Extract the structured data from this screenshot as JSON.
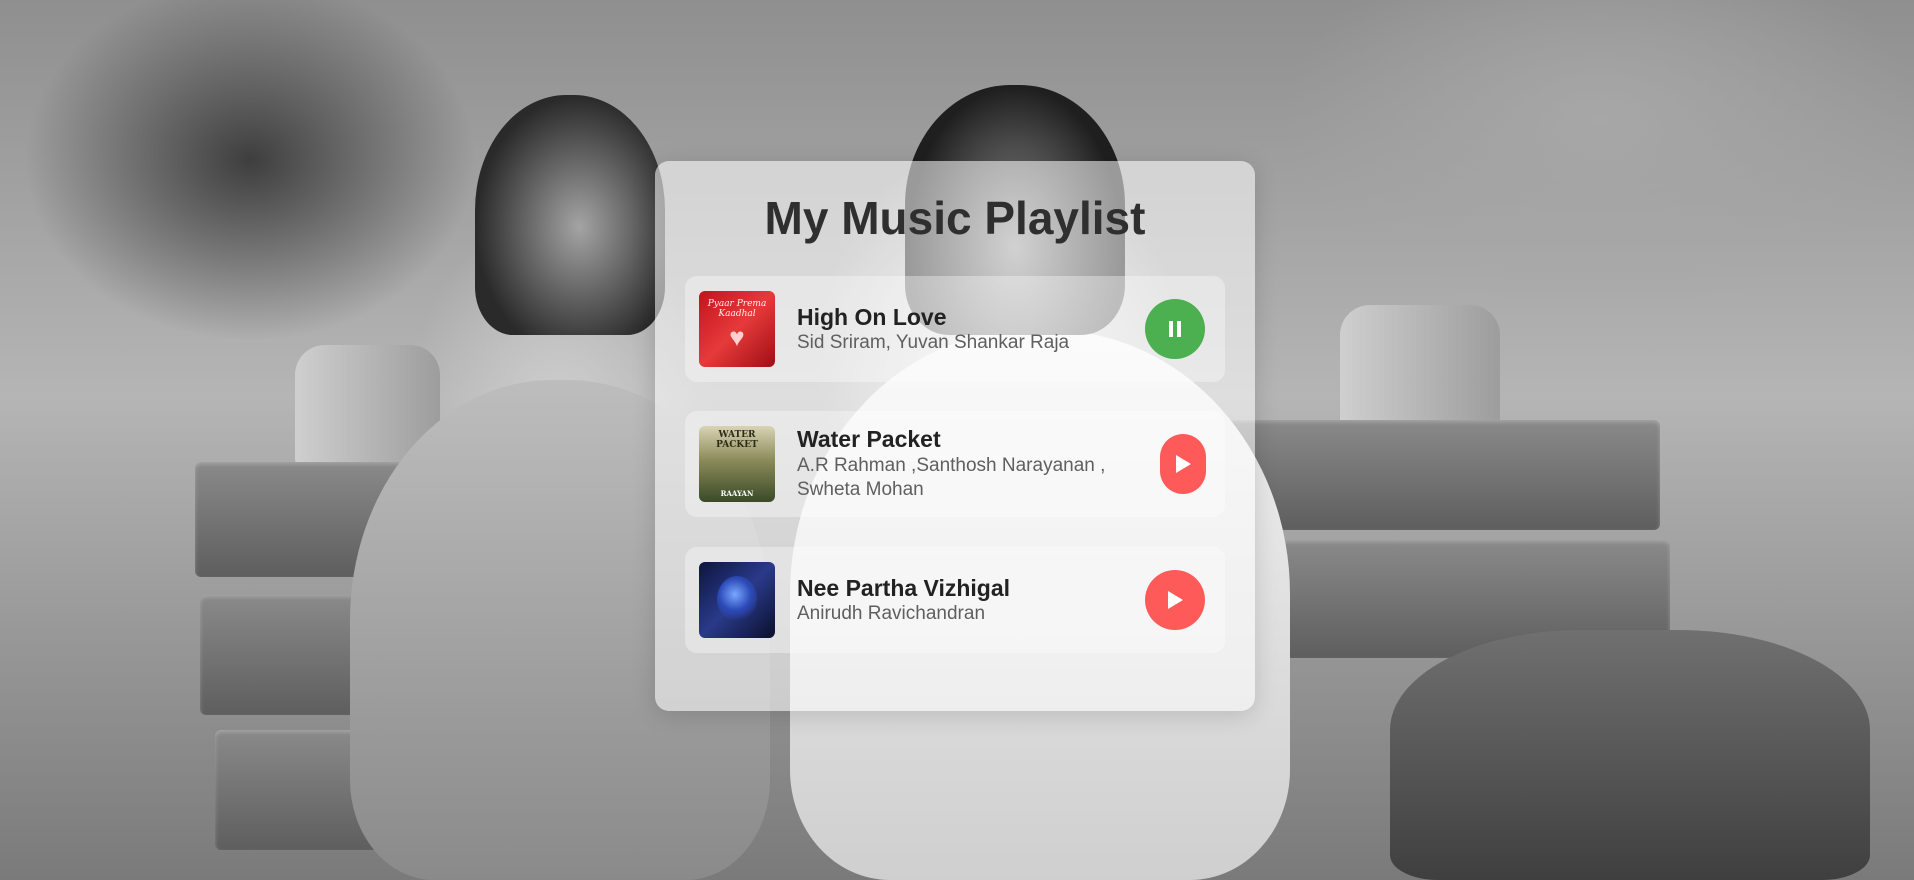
{
  "playlist": {
    "title": "My Music Playlist",
    "tracks": [
      {
        "name": "High On Love",
        "artist": "Sid Sriram, Yuvan Shankar Raja",
        "state": "playing",
        "button_icon": "pause-icon",
        "button_color": "#4caf50",
        "cover_text": "Pyaar Prema Kaadhal"
      },
      {
        "name": "Water Packet",
        "artist": "A.R Rahman ,Santhosh Narayanan , Swheta Mohan",
        "state": "paused",
        "button_icon": "play-icon",
        "button_color": "#ff5a5a",
        "cover_text": "WATER PACKET",
        "cover_subtext": "RAAYAN"
      },
      {
        "name": "Nee Partha Vizhigal",
        "artist": "Anirudh Ravichandran",
        "state": "paused",
        "button_icon": "play-icon",
        "button_color": "#ff5a5a"
      }
    ]
  },
  "colors": {
    "play_accent": "#ff5a5a",
    "active_accent": "#4caf50",
    "title_color": "#2f2f2f"
  }
}
